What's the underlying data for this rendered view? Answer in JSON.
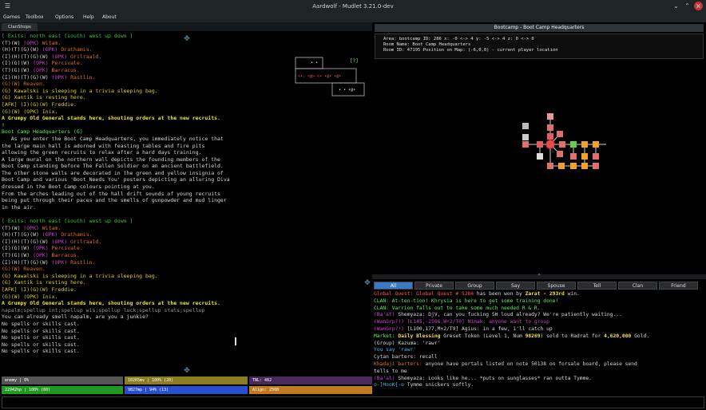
{
  "window": {
    "title": "Aardwolf - Mudlet 3.21.0-dev"
  },
  "menu": [
    "Games",
    "Toolbox",
    "Options",
    "Help",
    "About"
  ],
  "tabs": [
    "ClanShops"
  ],
  "room": {
    "exits_1": "[ Exits: north east (south) west up down ]",
    "players_1": [
      [
        "(T)(W)",
        "(OPK)",
        " Witam."
      ],
      [
        "(H)(T)(G)(W)",
        "(OPK)",
        " Drathamis."
      ],
      [
        "(I)(H)(T)(G)(W)",
        "(OPK)",
        " Grilraald."
      ],
      [
        "(I)(G)(W)",
        "(OPK)",
        " Percivale."
      ],
      [
        "(T)(G)(W)",
        "(OPK)",
        " Barracus."
      ],
      [
        "(I)(H)(T)(G)(W)",
        "(OPK)",
        " Rastlin."
      ]
    ],
    "reaven": "(G)(W) Reaven.",
    "kawalski": "(G) Kawalski is sleeping in a trivia sleeping bag.",
    "xantik": "(G) Xantik is resting here.",
    "freddie": "[AFK] (I)(G)(W) Freddie.",
    "inix": "(G)(W) (OPK) Inix.",
    "general": "A Grumpy Old General stands here, shouting orders at the new recruits.",
    "bang": "!",
    "room_name": "Boot Camp Headquarters (G)",
    "desc": [
      "   As you enter the Boot Camp Headquarters, you immediately notice that",
      "the large main hall is adorned with feasting tables and fire pits",
      "allowing the green recruits to relax after a hard days training.",
      "A large mural on the northern wall depicts the founding members of the",
      "Boot Camp standing before The Fallen Soldier on an ancient battlefield.",
      "The other stone walls are decorated in the green and yellow insignia of",
      "Boot Camp and various 'Boot Needs You' posters depicting an alluring Diva",
      "dressed in the Boot Camp colours pointing at you.",
      "From the arches leading out of the hall drift sounds of young recruits",
      "being put through their paces and the smells of gunpowder and mud linger",
      "in the air."
    ],
    "exits_2": "[ Exits: north east (south) west up down ]",
    "spellup": "napalm;spellup int;spellup wis;spellup luck;spellup stats;spellup",
    "smell": "You can already smell napalm, are you a junkie?",
    "no_spells": "No spells or skills cast."
  },
  "minimap": {
    "a": "<",
    "b": "[?]"
  },
  "bars": {
    "enemy": "enemy | 0%",
    "mana_top": "10265mv | 100%   (20)",
    "tnl": "TNL: 482",
    "hp": "22942hp | 100%   (60)",
    "mv": "9827mp | 94%   (13)",
    "align": "Align: 2500"
  },
  "mapper": {
    "title": "Bootcamp - Boot Camp Headquarters",
    "info_1": "Area: bootcamp ID: 286 x: -0 <-> 4 y: -5 <-> 4 z: 0 <-> 0",
    "info_2": "Room Name: Boot Camp Headquarters",
    "info_3": "Room ID: 47195 Position on Map: (-6,0,0) - current player location"
  },
  "chat_tabs": [
    "All",
    "Private",
    "Group",
    "Say",
    "Spouse",
    "Tell",
    "Clan",
    "Friend"
  ],
  "splitter": "^",
  "chat": {
    "l1a": "Global Quest: Global Quest # 5284",
    "l1b": " has been won by ",
    "l1c": "Zarat - 293rd",
    "l1d": " win.",
    "l2": "CLAN: At-ten-tion! Khrysia is here to get some training done!",
    "l3": "CLAN: Varrion falls out to take some much needed R & R.",
    "l4a": "(Ba'at)",
    "l4b": " Shemyaza: DjV, can you fucking SH loud already? We're patiently waiting...",
    "l5a": "(WanGrp?!)",
    "l5b": " [L145,-2566,W+2/T0] Nimak: anyone want to group",
    "l6a": "(WanGrp?!)",
    "l6b": " [L100,177,M+2/T9] Agius: in a few, i'll catch up",
    "l7a": "Market: ",
    "l7b": "Daily Blessing",
    "l7c": " Greset Token (Level 1, Num ",
    "l7d": "98269",
    "l7e": ") sold to Radrat for ",
    "l7f": "4,620,000",
    "l7g": " Gold.",
    "l8": "(Group) Kazuma: 'rawr'",
    "l9": "You say 'rawr'",
    "l10a": "Cytan barters: ",
    "l10b": "recall",
    "l11a": "Khadaji barters: ",
    "l11b": "anyone have portals listed on note 50138 on forsale board, please send",
    "l12": "tells to me",
    "l13a": "(Ba'at)",
    "l13b": " Shemyaza: Looks like he... *puts on sunglasses* ran outta Tymme.",
    "l14a": "o-]HooK{-o",
    "l14b": " Tymme snickers softly."
  }
}
